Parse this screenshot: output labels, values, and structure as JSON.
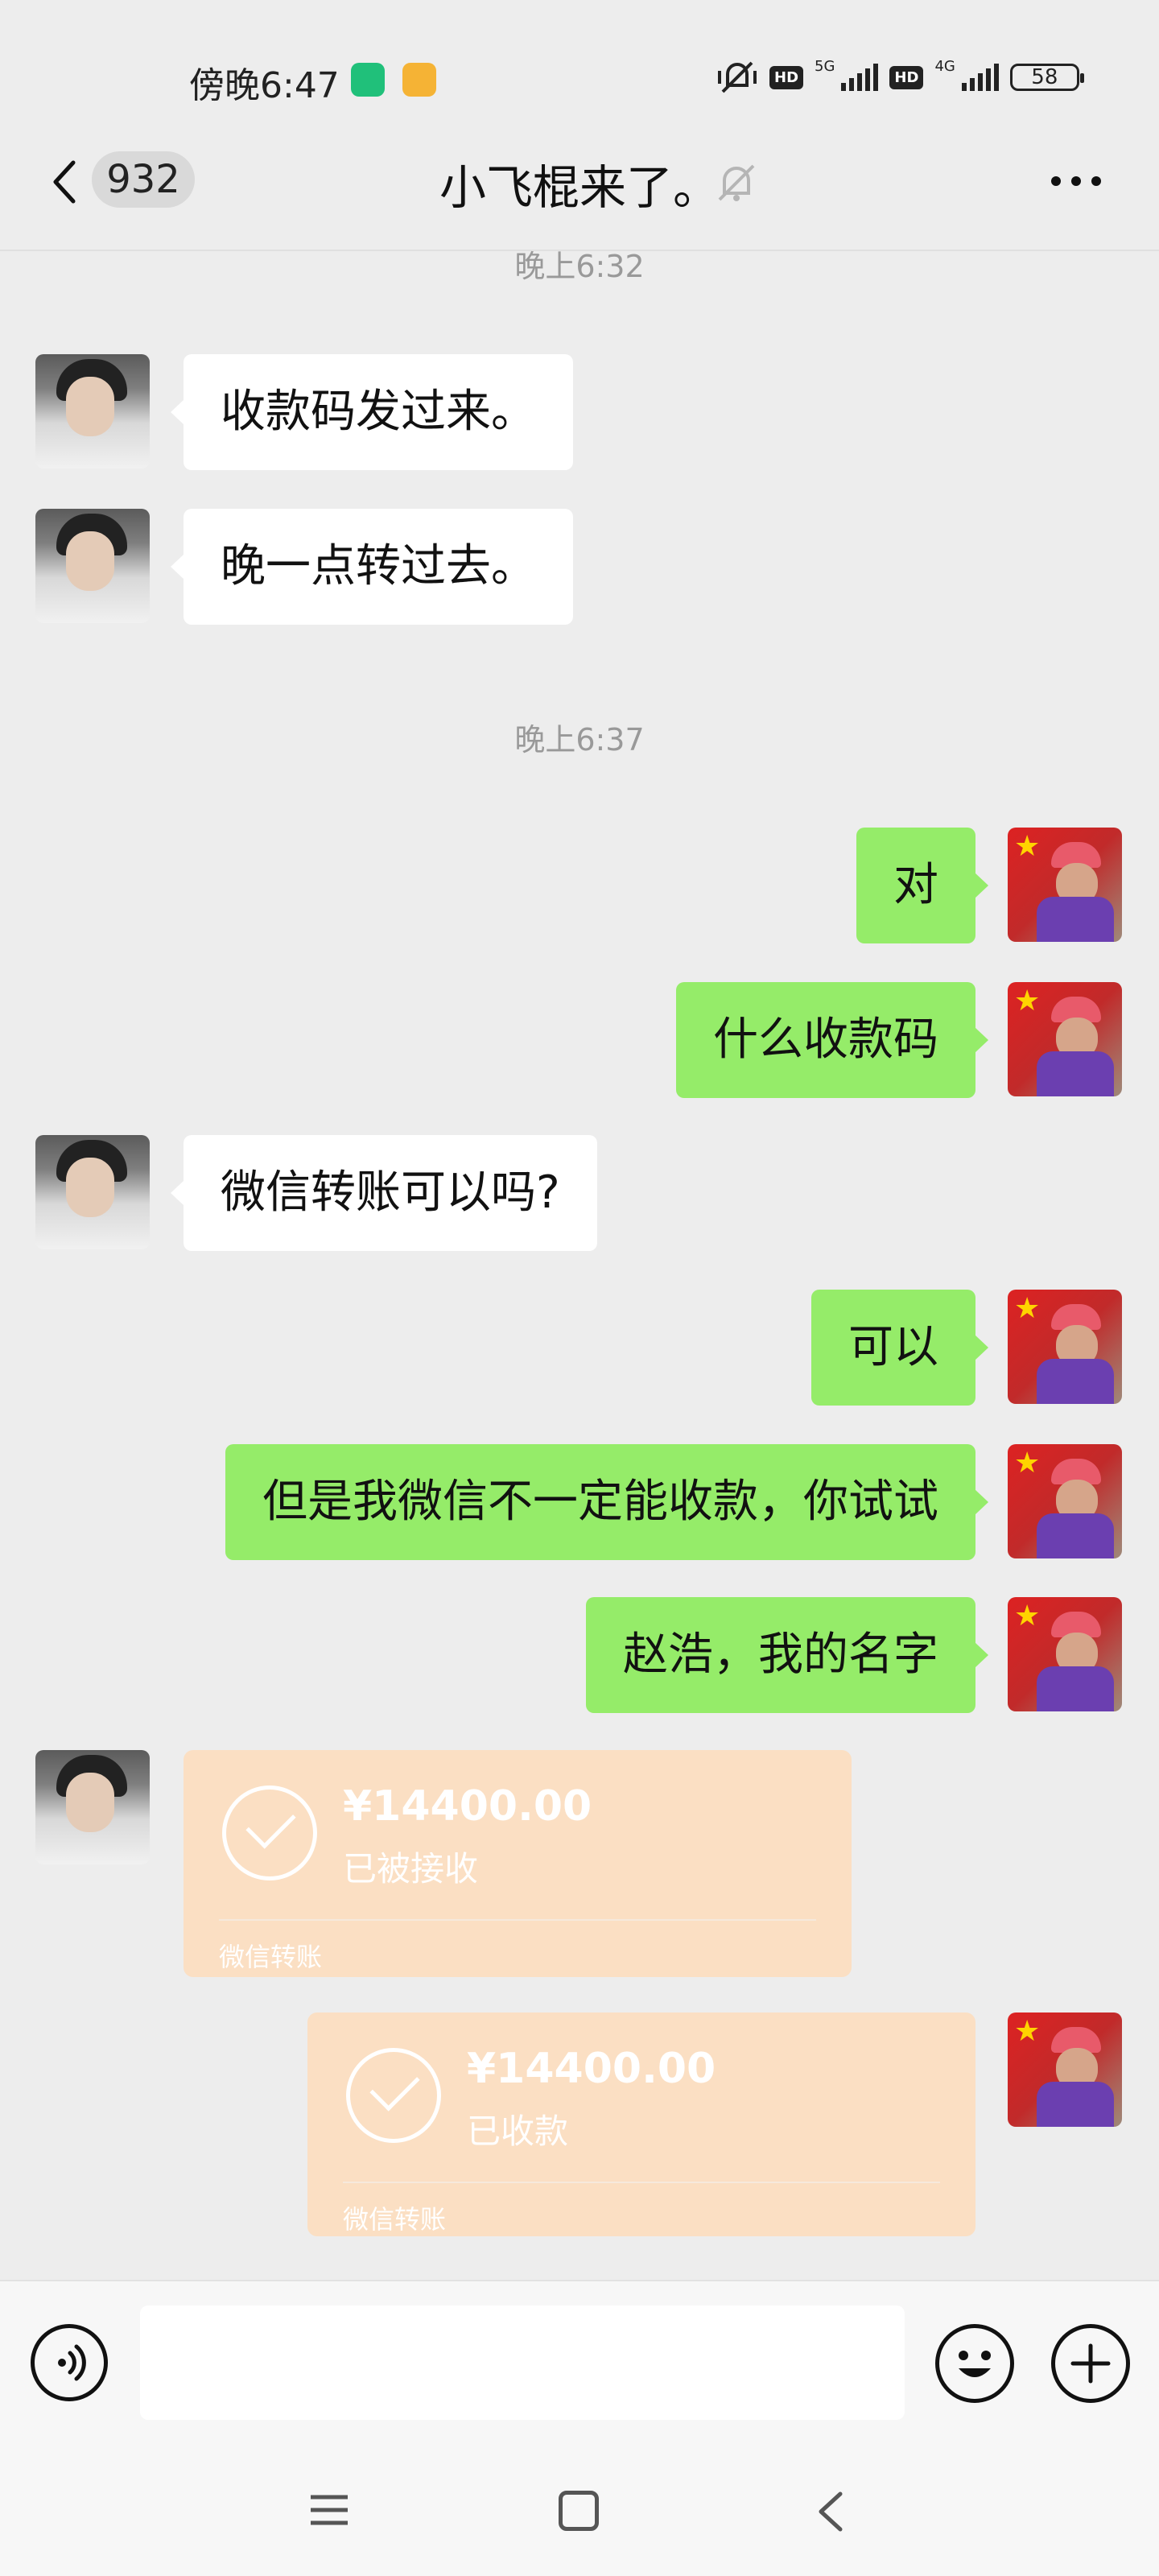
{
  "status_bar": {
    "time": "傍晚6:47",
    "network_1": "5G",
    "network_2": "4G",
    "hd": "HD",
    "battery": "58"
  },
  "header": {
    "back_icon": "chevron-left-icon",
    "unread_count": "932",
    "title": "小飞棍来了。",
    "mute_icon": "bell-slash-icon",
    "more_icon": "more-dots-icon"
  },
  "messages": [
    {
      "type": "time",
      "text": "晚上6:32"
    },
    {
      "type": "text",
      "side": "left",
      "text": "收款码发过来。"
    },
    {
      "type": "text",
      "side": "left",
      "text": "晚一点转过去。"
    },
    {
      "type": "time",
      "text": "晚上6:37"
    },
    {
      "type": "text",
      "side": "right",
      "text": "对"
    },
    {
      "type": "text",
      "side": "right",
      "text": "什么收款码"
    },
    {
      "type": "text",
      "side": "left",
      "text": "微信转账可以吗?"
    },
    {
      "type": "text",
      "side": "right",
      "text": "可以"
    },
    {
      "type": "text",
      "side": "right",
      "text": "但是我微信不一定能收款，你试试"
    },
    {
      "type": "text",
      "side": "right",
      "text": "赵浩，我的名字"
    },
    {
      "type": "transfer",
      "side": "left",
      "amount": "¥14400.00",
      "status": "已被接收",
      "source": "微信转账"
    },
    {
      "type": "transfer",
      "side": "right",
      "amount": "¥14400.00",
      "status": "已收款",
      "source": "微信转账"
    }
  ],
  "input_bar": {
    "voice_icon": "voice-icon",
    "emoji_icon": "emoji-icon",
    "plus_icon": "plus-icon",
    "placeholder": ""
  },
  "nav_bar": {
    "menu_icon": "menu-icon",
    "home_icon": "home-square-icon",
    "back_icon": "nav-back-icon"
  },
  "colors": {
    "background": "#ededed",
    "bubble_self": "#95ec69",
    "bubble_other": "#ffffff",
    "transfer_card": "#fbdfc3"
  }
}
